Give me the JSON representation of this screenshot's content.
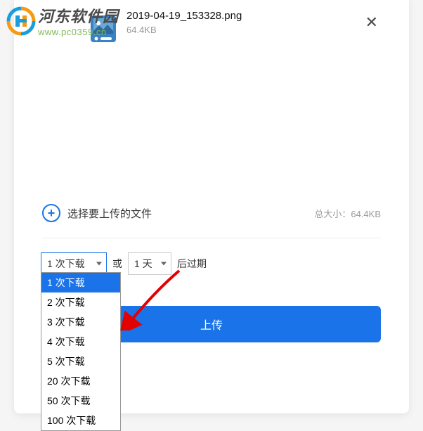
{
  "watermark": {
    "site_name": "河东软件园",
    "site_url": "www.pc0359.cn"
  },
  "file": {
    "name": "2019-04-19_153328.png",
    "size": "64.4KB"
  },
  "add_file": {
    "label": "选择要上传的文件",
    "total_label": "总大小：",
    "total_value": "64.4KB"
  },
  "options": {
    "download_select": "1 次下载",
    "or_text": "或",
    "days_select": "1 天",
    "after_text": "后过期",
    "dropdown": [
      "1 次下载",
      "2 次下载",
      "3 次下载",
      "4 次下载",
      "5 次下载",
      "20 次下载",
      "50 次下载",
      "100 次下载"
    ]
  },
  "upload_button": "上传"
}
